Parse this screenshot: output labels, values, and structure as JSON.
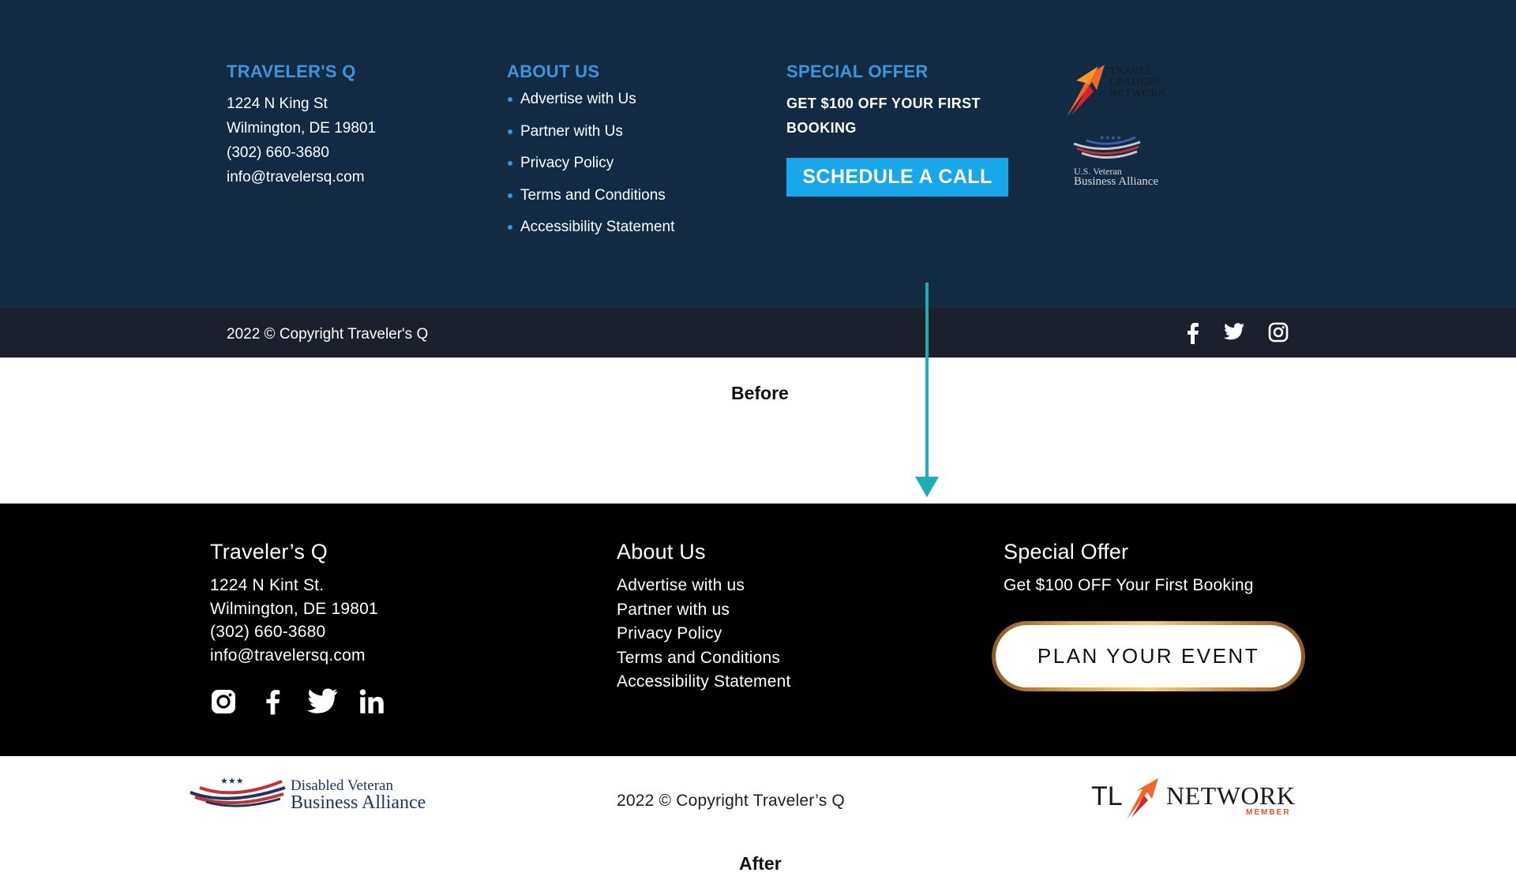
{
  "before": {
    "brand": {
      "title": "TRAVELER'S Q",
      "address1": "1224 N King St",
      "address2": "Wilmington, DE 19801",
      "phone": "(302) 660-3680",
      "email": "info@travelersq.com"
    },
    "about": {
      "title": "ABOUT US",
      "links": [
        "Advertise with Us",
        "Partner with Us",
        "Privacy Policy",
        "Terms and Conditions",
        "Accessibility Statement"
      ]
    },
    "offer": {
      "title": "SPECIAL OFFER",
      "text_line1": "GET $100 OFF YOUR FIRST",
      "text_line2": "BOOKING",
      "cta": "SCHEDULE A CALL"
    },
    "logos": {
      "travel_leaders": [
        "TRAVEL",
        "LEADERS",
        "NETWORK"
      ],
      "veteran_small": "U.S. Veteran",
      "veteran_big": "Business Alliance"
    },
    "copyright": "2022 © Copyright Traveler's Q",
    "social_icons": [
      "facebook-icon",
      "twitter-icon",
      "instagram-icon"
    ],
    "label": "Before"
  },
  "after": {
    "brand": {
      "title": "Traveler’s Q",
      "address1": "1224 N Kint St.",
      "address2": "Wilmington, DE 19801",
      "phone": "(302) 660-3680",
      "email": "info@travelersq.com"
    },
    "social_icons": [
      "instagram-icon",
      "facebook-icon",
      "twitter-icon",
      "linkedin-icon"
    ],
    "about": {
      "title": "About Us",
      "links": [
        "Advertise with us",
        "Partner with us",
        "Privacy Policy",
        "Terms and Conditions",
        "Accessibility Statement"
      ]
    },
    "offer": {
      "title": "Special Offer",
      "text": "Get $100 OFF Your First Booking",
      "cta": "PLAN YOUR EVENT"
    },
    "logos": {
      "dvba_line1": "Disabled Veteran",
      "dvba_line2": "Business Alliance",
      "tl_prefix": "TL",
      "tl_network": "NETWORK",
      "tl_member": "MEMBER"
    },
    "copyright": "2022 © Copyright Traveler’s Q",
    "label": "After"
  },
  "colors": {
    "before_bg": "#122b43",
    "before_bar": "#1c1f2c",
    "before_accent": "#3d95de",
    "before_cta": "#19a7ec",
    "after_bg": "#000000",
    "arrow": "#1eacb5",
    "gold_border": "#d9a548"
  }
}
